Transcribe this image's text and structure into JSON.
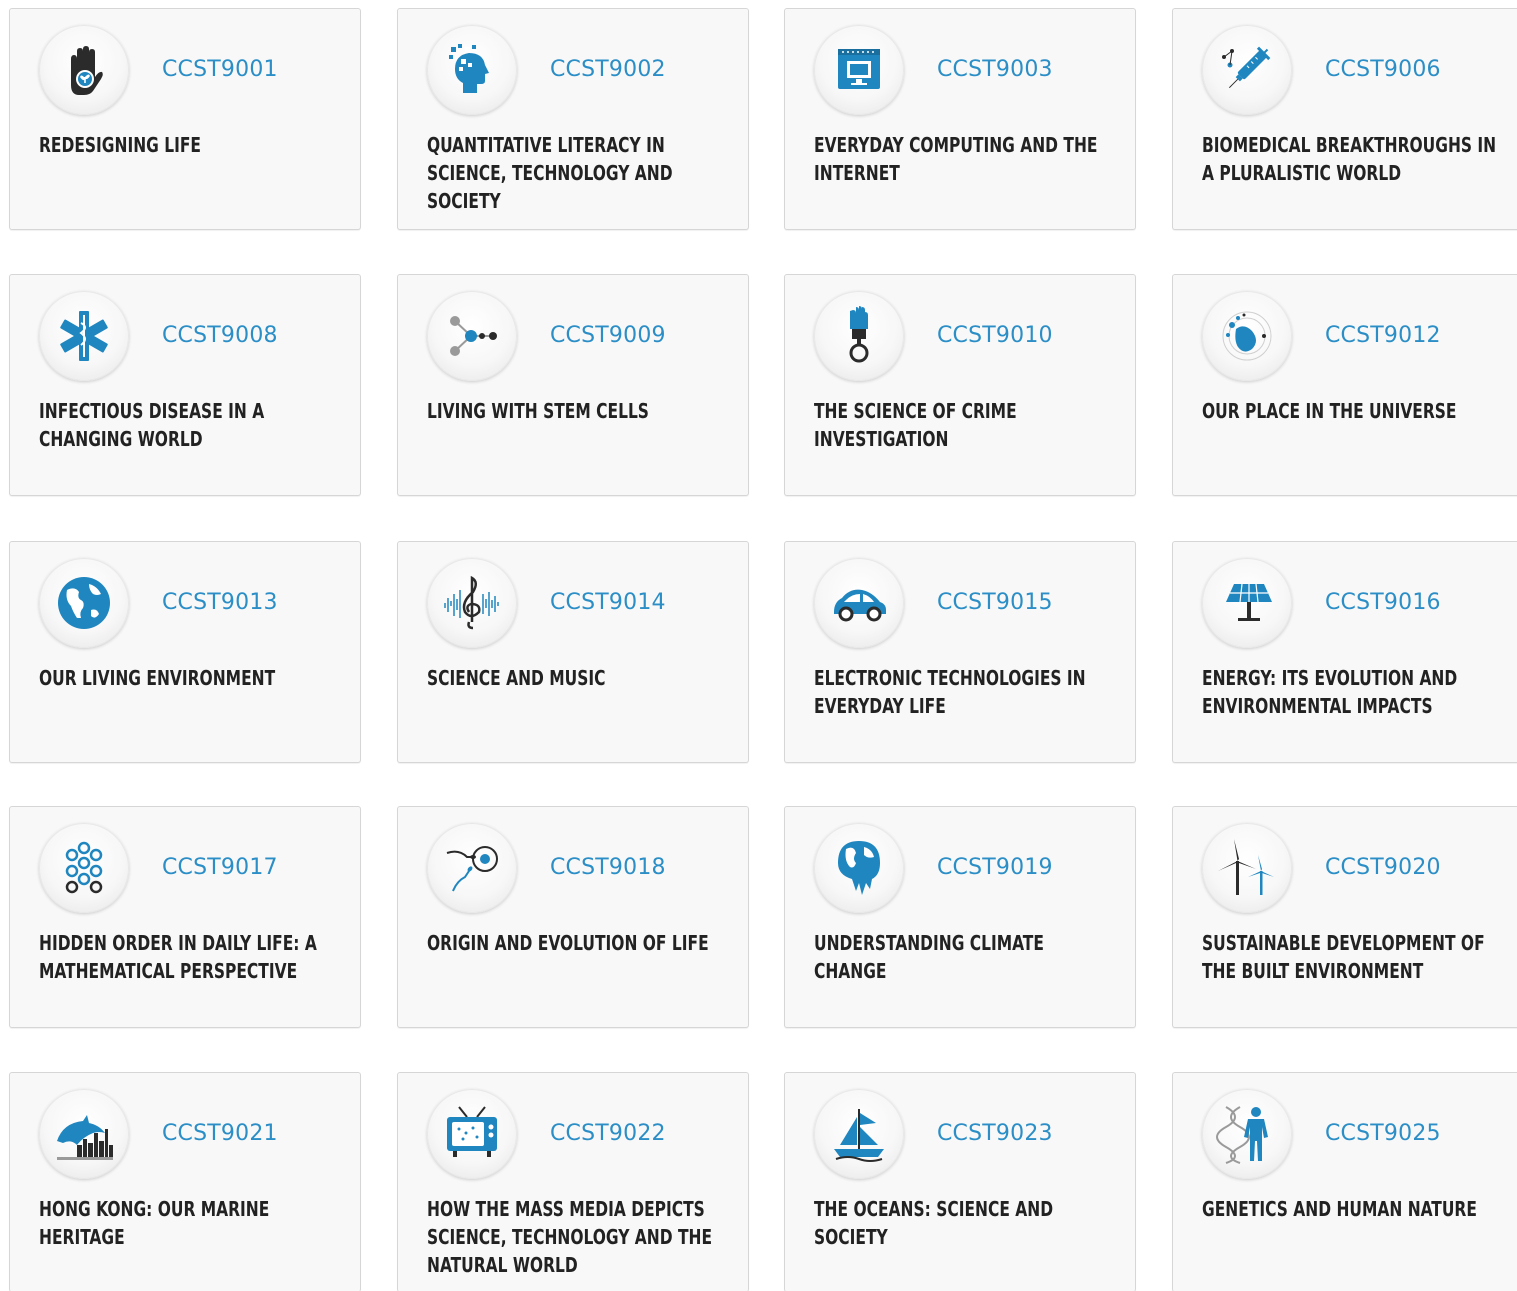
{
  "colors": {
    "accent": "#2b8ec6",
    "icon_blue": "#1f86bf",
    "icon_dark": "#2b2b2b",
    "title": "#222222",
    "card_bg": "#f8f8f8",
    "card_border": "#d6d6d6"
  },
  "courses": [
    {
      "code": "CCST9001",
      "title": "REDESIGNING LIFE",
      "icon": "hand-plant-icon"
    },
    {
      "code": "CCST9002",
      "title": "QUANTITATIVE LITERACY IN SCIENCE, TECHNOLOGY AND SOCIETY",
      "icon": "head-pixels-icon"
    },
    {
      "code": "CCST9003",
      "title": "EVERYDAY COMPUTING AND THE INTERNET",
      "icon": "computer-calendar-icon"
    },
    {
      "code": "CCST9006",
      "title": "BIOMEDICAL BREAKTHROUGHS IN A PLURALISTIC WORLD",
      "icon": "syringe-icon"
    },
    {
      "code": "CCST9008",
      "title": "INFECTIOUS DISEASE IN A CHANGING WORLD",
      "icon": "medical-star-icon"
    },
    {
      "code": "CCST9009",
      "title": "LIVING WITH STEM CELLS",
      "icon": "cell-network-icon"
    },
    {
      "code": "CCST9010",
      "title": "THE SCIENCE OF CRIME INVESTIGATION",
      "icon": "handcuff-fist-icon"
    },
    {
      "code": "CCST9012",
      "title": "OUR PLACE IN THE UNIVERSE",
      "icon": "planet-orbit-icon"
    },
    {
      "code": "CCST9013",
      "title": "OUR LIVING ENVIRONMENT",
      "icon": "globe-icon"
    },
    {
      "code": "CCST9014",
      "title": "SCIENCE AND MUSIC",
      "icon": "treble-clef-icon"
    },
    {
      "code": "CCST9015",
      "title": "ELECTRONIC TECHNOLOGIES IN EVERYDAY LIFE",
      "icon": "car-icon"
    },
    {
      "code": "CCST9016",
      "title": "ENERGY: ITS EVOLUTION AND ENVIRONMENTAL IMPACTS",
      "icon": "solar-panel-icon"
    },
    {
      "code": "CCST9017",
      "title": "HIDDEN ORDER IN DAILY LIFE: A MATHEMATICAL PERSPECTIVE",
      "icon": "circles-pattern-icon"
    },
    {
      "code": "CCST9018",
      "title": "ORIGIN AND EVOLUTION OF LIFE",
      "icon": "sperm-egg-icon"
    },
    {
      "code": "CCST9019",
      "title": "UNDERSTANDING CLIMATE CHANGE",
      "icon": "melting-globe-icon"
    },
    {
      "code": "CCST9020",
      "title": "SUSTAINABLE DEVELOPMENT OF THE BUILT ENVIRONMENT",
      "icon": "wind-turbine-icon"
    },
    {
      "code": "CCST9021",
      "title": "HONG KONG: OUR MARINE HERITAGE",
      "icon": "dolphin-skyline-icon"
    },
    {
      "code": "CCST9022",
      "title": "HOW THE MASS MEDIA DEPICTS SCIENCE, TECHNOLOGY AND THE NATURAL WORLD",
      "icon": "television-icon"
    },
    {
      "code": "CCST9023",
      "title": "THE OCEANS: SCIENCE AND SOCIETY",
      "icon": "sailboat-icon"
    },
    {
      "code": "CCST9025",
      "title": "GENETICS AND HUMAN NATURE",
      "icon": "dna-human-icon"
    }
  ]
}
